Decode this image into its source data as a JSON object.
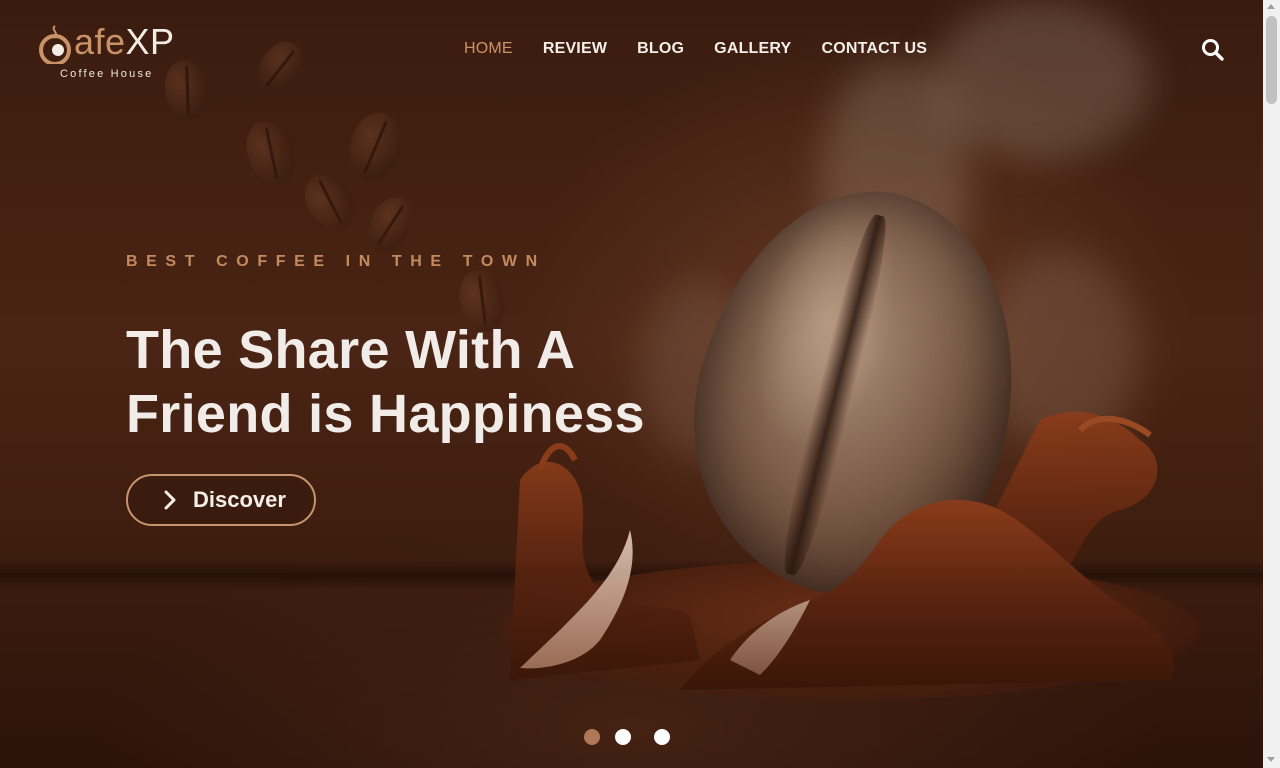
{
  "brand": {
    "logo_main": "afe",
    "logo_accent": "XP",
    "logo_subtitle": "Coffee House",
    "accent_color": "#c9936a"
  },
  "nav": {
    "items": [
      {
        "label": "HOME",
        "active": true
      },
      {
        "label": "REVIEW",
        "active": false
      },
      {
        "label": "BLOG",
        "active": false
      },
      {
        "label": "GALLERY",
        "active": false
      },
      {
        "label": "CONTACT US",
        "active": false
      }
    ],
    "search_icon": "search-icon"
  },
  "hero": {
    "tagline": "BEST COFFEE IN THE TOWN",
    "headline_line1": "The Share With A",
    "headline_line2": "Friend is Happiness",
    "cta_label": "Discover",
    "cta_icon": "chevron-right-icon"
  },
  "slider": {
    "dot_count": 3,
    "active_index": 0,
    "active_color": "#b07756"
  }
}
